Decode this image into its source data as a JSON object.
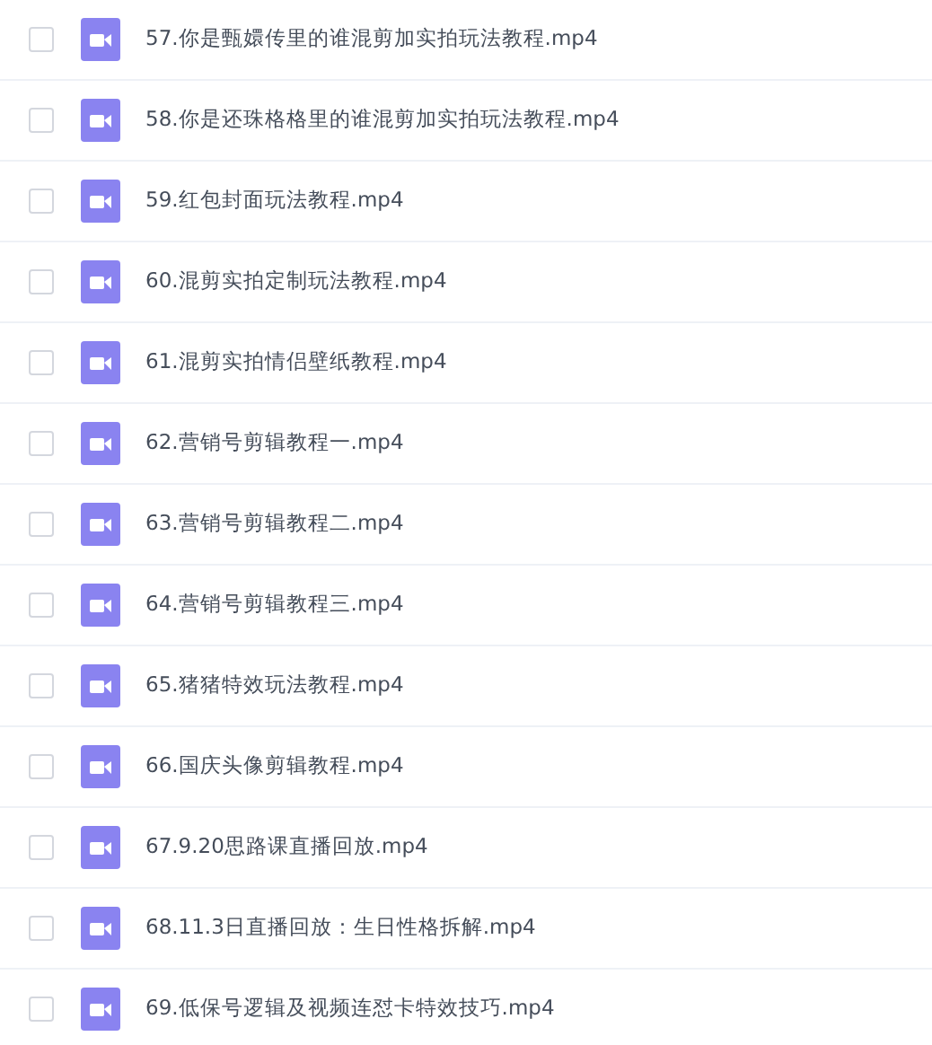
{
  "files": [
    {
      "name": "57.你是甄嬛传里的谁混剪加实拍玩法教程.mp4",
      "checked": false
    },
    {
      "name": "58.你是还珠格格里的谁混剪加实拍玩法教程.mp4",
      "checked": false
    },
    {
      "name": "59.红包封面玩法教程.mp4",
      "checked": false
    },
    {
      "name": "60.混剪实拍定制玩法教程.mp4",
      "checked": false
    },
    {
      "name": "61.混剪实拍情侣壁纸教程.mp4",
      "checked": false
    },
    {
      "name": "62.营销号剪辑教程一.mp4",
      "checked": false
    },
    {
      "name": "63.营销号剪辑教程二.mp4",
      "checked": false
    },
    {
      "name": "64.营销号剪辑教程三.mp4",
      "checked": false
    },
    {
      "name": "65.猪猪特效玩法教程.mp4",
      "checked": false
    },
    {
      "name": "66.国庆头像剪辑教程.mp4",
      "checked": false
    },
    {
      "name": "67.9.20思路课直播回放.mp4",
      "checked": false
    },
    {
      "name": "68.11.3日直播回放：生日性格拆解.mp4",
      "checked": false
    },
    {
      "name": "69.低保号逻辑及视频连怼卡特效技巧.mp4",
      "checked": false
    }
  ]
}
